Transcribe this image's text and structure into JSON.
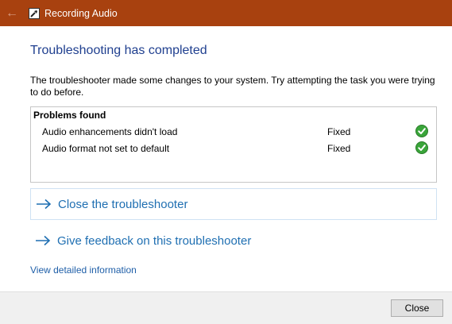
{
  "window": {
    "title": "Recording Audio",
    "titlebar_color": "#a8410f"
  },
  "main": {
    "heading": "Troubleshooting has completed",
    "description": "The troubleshooter made some changes to your system. Try attempting the task you were trying to do before.",
    "problems": {
      "title": "Problems found",
      "items": [
        {
          "name": "Audio enhancements didn't load",
          "status": "Fixed",
          "icon": "green-check-icon"
        },
        {
          "name": "Audio format not set to default",
          "status": "Fixed",
          "icon": "green-check-icon"
        }
      ]
    },
    "actions": [
      {
        "label": "Close the troubleshooter",
        "icon": "arrow-right-icon"
      },
      {
        "label": "Give feedback on this troubleshooter",
        "icon": "arrow-right-icon"
      }
    ],
    "detail_link": "View detailed information"
  },
  "footer": {
    "close_label": "Close"
  },
  "colors": {
    "heading": "#1f3f8f",
    "link": "#1f6fb2",
    "check": "#3aa53a"
  }
}
